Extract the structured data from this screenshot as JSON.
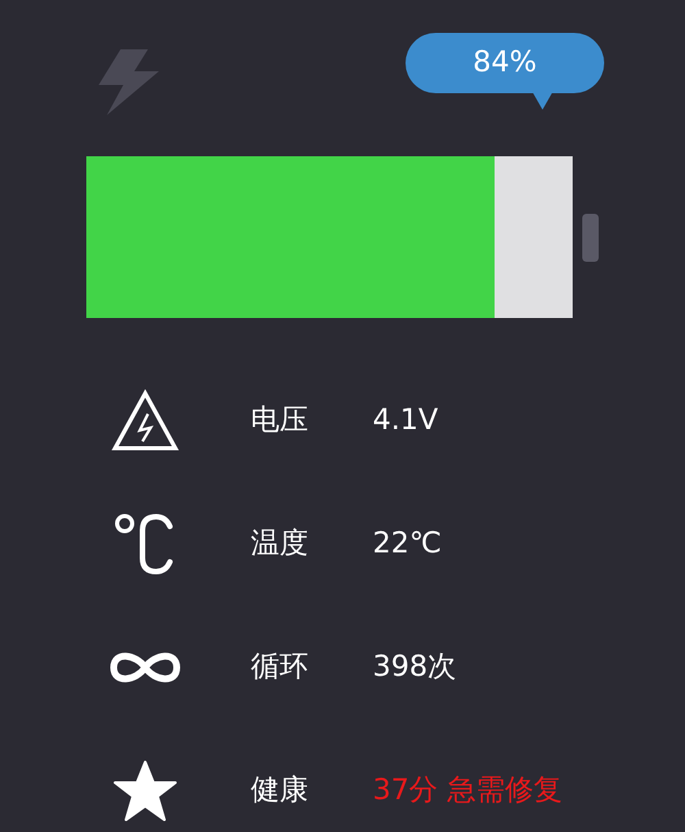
{
  "charging": false,
  "percent_bubble": "84%",
  "battery": {
    "level": 0.84
  },
  "stats": [
    {
      "kind": "voltage",
      "label": "电压",
      "value": "4.1V",
      "alert": false
    },
    {
      "kind": "temperature",
      "label": "温度",
      "value": "22℃",
      "alert": false
    },
    {
      "kind": "cycles",
      "label": "循环",
      "value": "398次",
      "alert": false
    },
    {
      "kind": "health",
      "label": "健康",
      "value": "37分 急需修复",
      "alert": true
    }
  ]
}
